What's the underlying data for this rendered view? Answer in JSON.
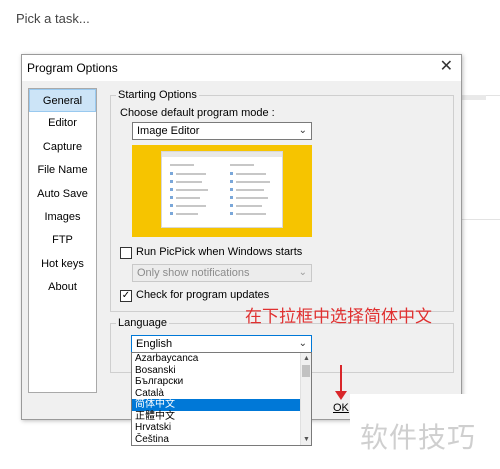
{
  "background": {
    "prompt": "Pick a task..."
  },
  "dialog": {
    "title": "Program Options",
    "close_glyph": "✕",
    "nav": [
      "General",
      "Editor",
      "Capture",
      "File Name",
      "Auto Save",
      "Images",
      "FTP",
      "Hot keys",
      "About"
    ],
    "nav_selected": "General"
  },
  "starting": {
    "group_title": "Starting Options",
    "mode_label": "Choose default program mode :",
    "mode_value": "Image Editor",
    "run_at_start_label": "Run PicPick when Windows starts",
    "run_at_start_checked": false,
    "notify_value": "Only show notifications",
    "check_updates_label": "Check for program updates",
    "check_updates_checked": true,
    "check_mark": "✓"
  },
  "language": {
    "group_title": "Language",
    "selected": "English",
    "options": [
      "Azarbaycanca",
      "Bosanski",
      "Български",
      "Català",
      "简体中文",
      "正體中文",
      "Hrvatski",
      "Čeština"
    ],
    "highlighted_index": 4
  },
  "ok_label": "OK",
  "arrow_glyph": "⌄",
  "annotation": "在下拉框中选择简体中文",
  "watermark": "软件技巧",
  "colors": {
    "annotation": "#e03030",
    "highlight": "#0078d7",
    "preview_bg": "#f6c400"
  }
}
